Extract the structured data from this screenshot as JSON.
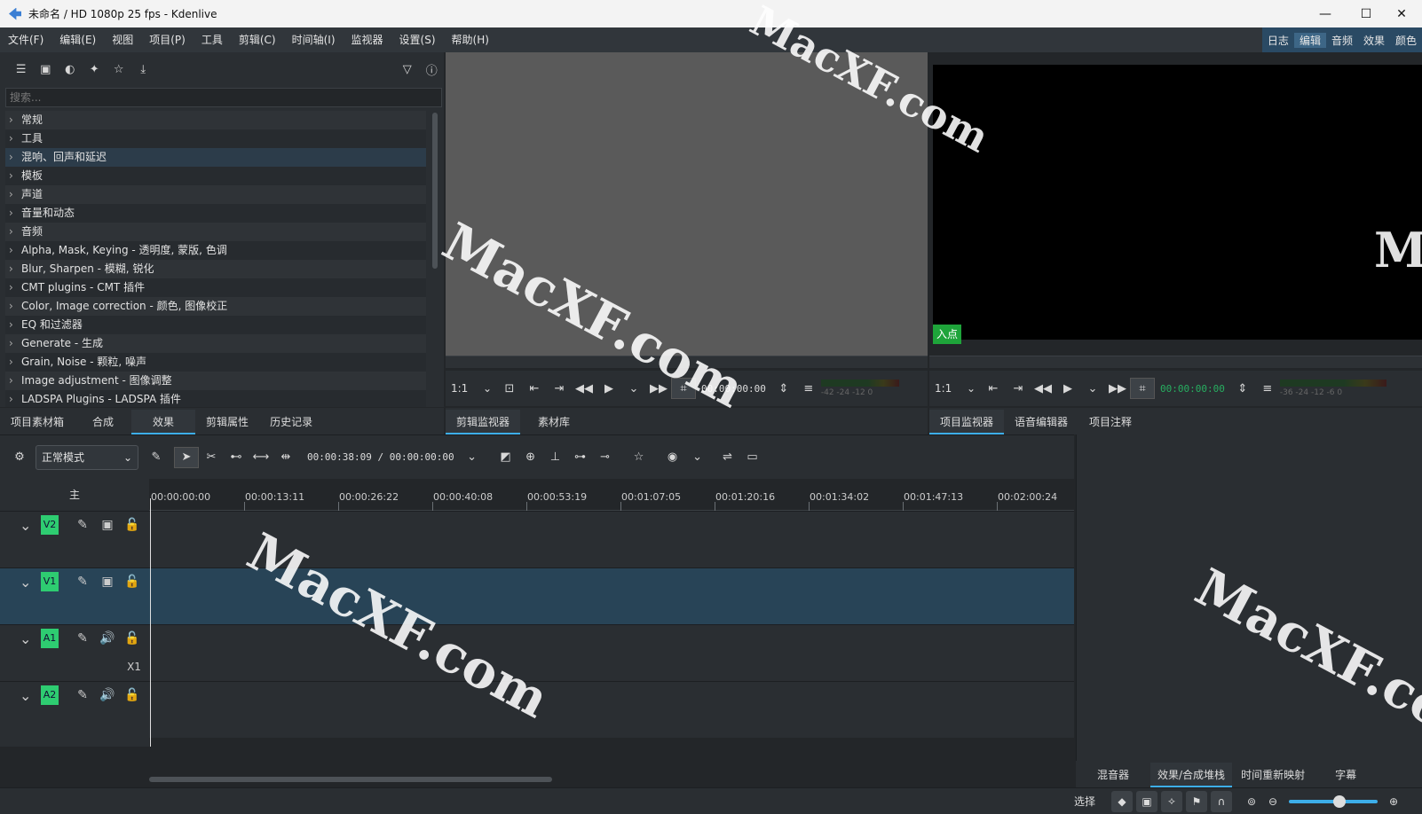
{
  "window": {
    "title": "未命名 / HD 1080p 25 fps - Kdenlive",
    "minimize": "—",
    "maximize": "☐",
    "close": "✕"
  },
  "menu": [
    "文件(F)",
    "编辑(E)",
    "视图",
    "项目(P)",
    "工具",
    "剪辑(C)",
    "时间轴(I)",
    "监视器",
    "设置(S)",
    "帮助(H)"
  ],
  "layouts": [
    "日志",
    "编辑",
    "音频",
    "效果",
    "颜色"
  ],
  "effects": {
    "search_placeholder": "搜索...",
    "items": [
      "常规",
      "工具",
      "混响、回声和延迟",
      "模板",
      "声道",
      "音量和动态",
      "音频",
      "Alpha, Mask, Keying - 透明度, 蒙版, 色调",
      "Blur, Sharpen - 模糊, 锐化",
      "CMT plugins - CMT 插件",
      "Color, Image correction - 颜色, 图像校正",
      "EQ 和过滤器",
      "Generate - 生成",
      "Grain, Noise - 颗粒, 噪声",
      "Image adjustment - 图像调整",
      "LADSPA Plugins - LADSPA 插件"
    ]
  },
  "left_tabs": [
    "项目素材箱",
    "合成",
    "效果",
    "剪辑属性",
    "历史记录"
  ],
  "clip_monitor": {
    "zoom": "1:1",
    "timecode": "00:00:00:00",
    "vu": "-42 -24 -12 0"
  },
  "project_monitor": {
    "zoom": "1:1",
    "timecode": "00:00:00:00",
    "in_point": "入点",
    "vu": "-36 -24 -12 -6 0"
  },
  "clip_tabs": [
    "剪辑监视器",
    "素材库"
  ],
  "project_tabs": [
    "项目监视器",
    "语音编辑器",
    "项目注释"
  ],
  "timeline": {
    "mode": "正常模式",
    "timecode": "00:00:38:09 / 00:00:00:00",
    "master": "主",
    "ruler": [
      "00:00:00:00",
      "00:00:13:11",
      "00:00:26:22",
      "00:00:40:08",
      "00:00:53:19",
      "00:01:07:05",
      "00:01:20:16",
      "00:01:34:02",
      "00:01:47:13",
      "00:02:00:24"
    ],
    "tracks": [
      {
        "name": "V2",
        "type": "video"
      },
      {
        "name": "V1",
        "type": "video"
      },
      {
        "name": "A1",
        "type": "audio"
      },
      {
        "name": "A2",
        "type": "audio"
      }
    ],
    "a1_label": "X1"
  },
  "right_tabs": [
    "混音器",
    "效果/合成堆栈",
    "时间重新映射",
    "字幕"
  ],
  "status": {
    "tool": "选择"
  },
  "watermark": "MacXF.com"
}
